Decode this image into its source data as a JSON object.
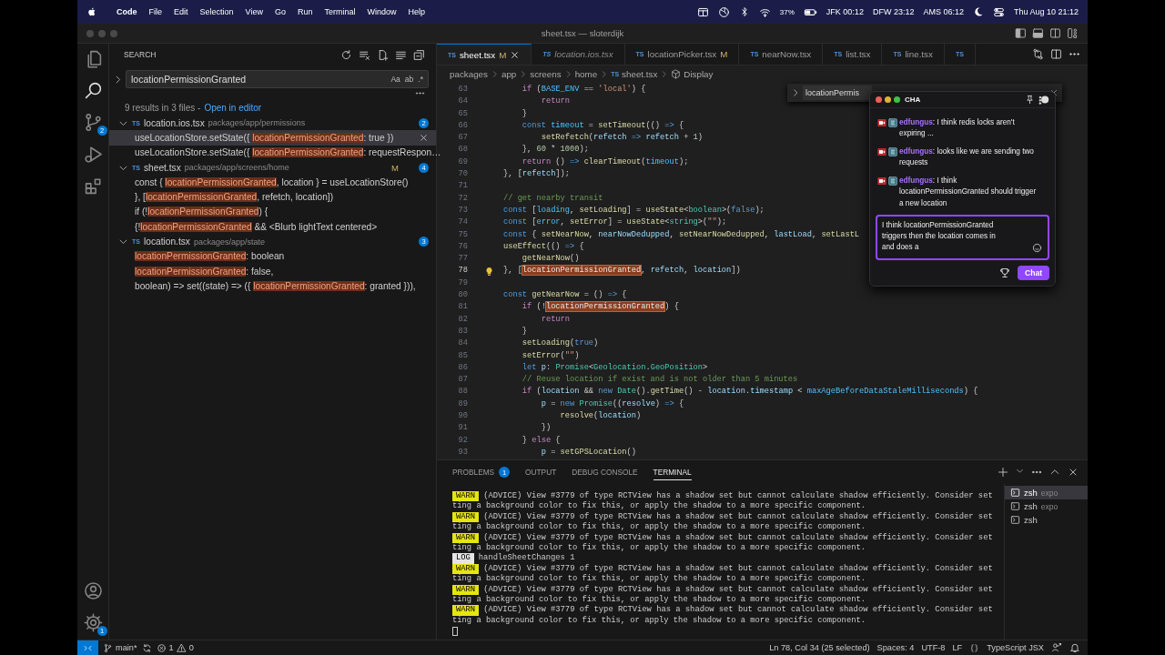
{
  "menu_bar": {
    "app": "Code",
    "items": [
      "File",
      "Edit",
      "Selection",
      "View",
      "Go",
      "Run",
      "Terminal",
      "Window",
      "Help"
    ],
    "battery": "37%",
    "clocks": [
      "JFK 00:12",
      "DFW 23:12",
      "AMS 06:12"
    ],
    "datetime": "Thu Aug 10 21:12"
  },
  "window": {
    "title": "sheet.tsx — sloterdijk"
  },
  "activity_bar": {
    "items": [
      {
        "kind": "files",
        "selected": false
      },
      {
        "kind": "search",
        "selected": true
      },
      {
        "kind": "scm",
        "selected": false,
        "badge": "2"
      },
      {
        "kind": "debug",
        "selected": false
      },
      {
        "kind": "extensions",
        "selected": false
      }
    ],
    "bottom": [
      {
        "kind": "account"
      },
      {
        "kind": "settings",
        "badge": "1"
      }
    ]
  },
  "sidebar": {
    "title": "SEARCH",
    "query": "locationPermissionGranted",
    "options": [
      "Aa",
      "ab",
      ".*"
    ],
    "summary": "9 results in 3 files -",
    "open_link": "Open in editor",
    "files": [
      {
        "lang": "TS",
        "name": "location.ios.tsx",
        "path": "packages/app/permissions",
        "count": "2",
        "expanded": true,
        "matches": [
          {
            "before": "useLocationStore.setState({ ",
            "match": "locationPermissionGranted",
            "after": ": true })",
            "selected": true
          },
          {
            "before": "useLocationStore.setState({ ",
            "match": "locationPermissionGranted",
            "after": ": requestRespon…",
            "selected": false
          }
        ]
      },
      {
        "lang": "TS",
        "name": "sheet.tsx",
        "path": "packages/app/screens/home",
        "status": "M",
        "count": "4",
        "expanded": true,
        "matches": [
          {
            "before": "const { ",
            "match": "locationPermissionGranted",
            "after": ", location } = useLocationStore()",
            "selected": false
          },
          {
            "before": "}, [",
            "match": "locationPermissionGranted",
            "after": ", refetch, location])",
            "selected": false
          },
          {
            "before": "if (!",
            "match": "locationPermissionGranted",
            "after": ") {",
            "selected": false
          },
          {
            "before": "{!",
            "match": "locationPermissionGranted",
            "after": " && <Blurb lightText centered>",
            "selected": false
          }
        ]
      },
      {
        "lang": "TS",
        "name": "location.tsx",
        "path": "packages/app/state",
        "count": "3",
        "expanded": true,
        "matches": [
          {
            "match": "locationPermissionGranted",
            "after": ": boolean",
            "selected": false
          },
          {
            "match": "locationPermissionGranted",
            "after": ": false,",
            "selected": false
          },
          {
            "before": "boolean) => set((state) => ({ ",
            "match": "locationPermissionGranted",
            "after": ": granted })),",
            "selected": false
          }
        ]
      }
    ]
  },
  "editor": {
    "tabs": [
      {
        "lang": "TS",
        "label": "sheet.tsx",
        "status": "M",
        "selected": true,
        "preview": false
      },
      {
        "lang": "TS",
        "label": "location.ios.tsx",
        "selected": false,
        "preview": true
      },
      {
        "lang": "TS",
        "label": "locationPicker.tsx",
        "status": "M",
        "selected": false,
        "preview": false
      },
      {
        "lang": "TS",
        "label": "nearNow.tsx",
        "selected": false,
        "preview": false
      },
      {
        "lang": "TS",
        "label": "list.tsx",
        "selected": false,
        "preview": false
      },
      {
        "lang": "TS",
        "label": "line.tsx",
        "selected": false,
        "preview": false
      },
      {
        "lang": "TS",
        "selected": false,
        "preview": false
      }
    ],
    "breadcrumbs": [
      {
        "label": "packages"
      },
      {
        "label": "app"
      },
      {
        "label": "screens"
      },
      {
        "label": "home"
      },
      {
        "lang": "TS",
        "label": "sheet.tsx"
      },
      {
        "kind": "symbol",
        "label": "Display"
      }
    ],
    "find_widget": {
      "query": "locationPermis"
    },
    "lines": [
      {
        "number": "63",
        "current": false,
        "segs": [
          {
            "text": "    if",
            "kind": "ctl"
          },
          {
            "text": " (",
            "kind": "plain"
          },
          {
            "text": "BASE_ENV",
            "kind": "const"
          },
          {
            "text": " == ",
            "kind": "plain"
          },
          {
            "text": "'local'",
            "kind": "str"
          },
          {
            "text": ") {",
            "kind": "plain"
          }
        ]
      },
      {
        "number": "64",
        "current": false,
        "segs": [
          {
            "text": "        return",
            "kind": "ctl"
          }
        ]
      },
      {
        "number": "65",
        "current": false,
        "segs": [
          {
            "text": "    }",
            "kind": "plain"
          }
        ]
      },
      {
        "number": "66",
        "current": false,
        "segs": [
          {
            "text": "    const",
            "kind": "kw"
          },
          {
            "text": " timeout",
            "kind": "const"
          },
          {
            "text": " = ",
            "kind": "plain"
          },
          {
            "text": "setTimeout",
            "kind": "fn"
          },
          {
            "text": "(() ",
            "kind": "plain"
          },
          {
            "text": "=>",
            "kind": "kw"
          },
          {
            "text": " {",
            "kind": "plain"
          }
        ]
      },
      {
        "number": "67",
        "current": false,
        "segs": [
          {
            "text": "        setRefetch",
            "kind": "fn"
          },
          {
            "text": "(",
            "kind": "plain"
          },
          {
            "text": "refetch",
            "kind": "var"
          },
          {
            "text": " => ",
            "kind": "kw"
          },
          {
            "text": "refetch",
            "kind": "var"
          },
          {
            "text": " + ",
            "kind": "plain"
          },
          {
            "text": "1",
            "kind": "num"
          },
          {
            "text": ")",
            "kind": "plain"
          }
        ]
      },
      {
        "number": "68",
        "current": false,
        "segs": [
          {
            "text": "    }, ",
            "kind": "plain"
          },
          {
            "text": "60",
            "kind": "num"
          },
          {
            "text": " * ",
            "kind": "plain"
          },
          {
            "text": "1000",
            "kind": "num"
          },
          {
            "text": ");",
            "kind": "plain"
          }
        ]
      },
      {
        "number": "69",
        "current": false,
        "segs": [
          {
            "text": "    return",
            "kind": "ctl"
          },
          {
            "text": " () ",
            "kind": "plain"
          },
          {
            "text": "=>",
            "kind": "kw"
          },
          {
            "text": " clearTimeout",
            "kind": "fn"
          },
          {
            "text": "(",
            "kind": "plain"
          },
          {
            "text": "timeout",
            "kind": "const"
          },
          {
            "text": ");",
            "kind": "plain"
          }
        ]
      },
      {
        "number": "70",
        "current": false,
        "segs": [
          {
            "text": "}, [",
            "kind": "plain"
          },
          {
            "text": "refetch",
            "kind": "var"
          },
          {
            "text": "]);",
            "kind": "plain"
          }
        ]
      },
      {
        "number": "71",
        "current": false
      },
      {
        "number": "72",
        "current": false,
        "segs": [
          {
            "text": "// get nearby transit",
            "kind": "comment"
          }
        ]
      },
      {
        "number": "73",
        "current": false,
        "segs": [
          {
            "text": "const",
            "kind": "kw"
          },
          {
            "text": " [",
            "kind": "plain"
          },
          {
            "text": "loading",
            "kind": "const"
          },
          {
            "text": ", ",
            "kind": "plain"
          },
          {
            "text": "setLoading",
            "kind": "fn"
          },
          {
            "text": "] = ",
            "kind": "plain"
          },
          {
            "text": "useState",
            "kind": "fn"
          },
          {
            "text": "<",
            "kind": "plain"
          },
          {
            "text": "boolean",
            "kind": "type"
          },
          {
            "text": ">(",
            "kind": "plain"
          },
          {
            "text": "false",
            "kind": "kw"
          },
          {
            "text": ");",
            "kind": "plain"
          }
        ]
      },
      {
        "number": "74",
        "current": false,
        "segs": [
          {
            "text": "const",
            "kind": "kw"
          },
          {
            "text": " [",
            "kind": "plain"
          },
          {
            "text": "error",
            "kind": "const"
          },
          {
            "text": ", ",
            "kind": "plain"
          },
          {
            "text": "setError",
            "kind": "fn"
          },
          {
            "text": "] = ",
            "kind": "plain"
          },
          {
            "text": "useState",
            "kind": "fn"
          },
          {
            "text": "<",
            "kind": "plain"
          },
          {
            "text": "string",
            "kind": "type"
          },
          {
            "text": ">(",
            "kind": "plain"
          },
          {
            "text": "\"\"",
            "kind": "str"
          },
          {
            "text": ");",
            "kind": "plain"
          }
        ]
      },
      {
        "number": "75",
        "current": false,
        "segs": [
          {
            "text": "const",
            "kind": "kw"
          },
          {
            "text": " { ",
            "kind": "plain"
          },
          {
            "text": "setNearNow",
            "kind": "fn"
          },
          {
            "text": ", ",
            "kind": "plain"
          },
          {
            "text": "nearNowDedupped",
            "kind": "var"
          },
          {
            "text": ", ",
            "kind": "plain"
          },
          {
            "text": "setNearNowDedupped",
            "kind": "fn"
          },
          {
            "text": ", ",
            "kind": "plain"
          },
          {
            "text": "lastLoad",
            "kind": "var"
          },
          {
            "text": ", ",
            "kind": "plain"
          },
          {
            "text": "setLastL",
            "kind": "fn"
          }
        ]
      },
      {
        "number": "76",
        "current": false,
        "segs": [
          {
            "text": "useEffect",
            "kind": "fn"
          },
          {
            "text": "(() ",
            "kind": "plain"
          },
          {
            "text": "=>",
            "kind": "kw"
          },
          {
            "text": " {",
            "kind": "plain"
          }
        ]
      },
      {
        "number": "77",
        "current": false,
        "segs": [
          {
            "text": "    getNearNow",
            "kind": "fn"
          },
          {
            "text": "()",
            "kind": "plain"
          }
        ]
      },
      {
        "number": "78",
        "current": true,
        "segs": [
          {
            "text": "}, [",
            "kind": "plain"
          },
          {
            "text": "locationPermissionGranted",
            "kind": "match"
          },
          {
            "text": ", ",
            "kind": "plain"
          },
          {
            "text": "refetch",
            "kind": "var"
          },
          {
            "text": ", ",
            "kind": "plain"
          },
          {
            "text": "location",
            "kind": "var"
          },
          {
            "text": "])",
            "kind": "plain"
          }
        ]
      },
      {
        "number": "79",
        "current": false
      },
      {
        "number": "80",
        "current": false,
        "segs": [
          {
            "text": "const",
            "kind": "kw"
          },
          {
            "text": " getNearNow",
            "kind": "fn"
          },
          {
            "text": " = () ",
            "kind": "plain"
          },
          {
            "text": "=>",
            "kind": "kw"
          },
          {
            "text": " {",
            "kind": "plain"
          }
        ]
      },
      {
        "number": "81",
        "current": false,
        "segs": [
          {
            "text": "    if",
            "kind": "ctl"
          },
          {
            "text": " (!",
            "kind": "plain"
          },
          {
            "text": "locationPermissionGranted",
            "kind": "match"
          },
          {
            "text": ") {",
            "kind": "plain"
          }
        ]
      },
      {
        "number": "82",
        "current": false,
        "segs": [
          {
            "text": "        return",
            "kind": "ctl"
          }
        ]
      },
      {
        "number": "83",
        "current": false,
        "segs": [
          {
            "text": "    }",
            "kind": "plain"
          }
        ]
      },
      {
        "number": "84",
        "current": false,
        "segs": [
          {
            "text": "    setLoading",
            "kind": "fn"
          },
          {
            "text": "(",
            "kind": "plain"
          },
          {
            "text": "true",
            "kind": "kw"
          },
          {
            "text": ")",
            "kind": "plain"
          }
        ]
      },
      {
        "number": "85",
        "current": false,
        "segs": [
          {
            "text": "    setError",
            "kind": "fn"
          },
          {
            "text": "(",
            "kind": "plain"
          },
          {
            "text": "\"\"",
            "kind": "str"
          },
          {
            "text": ")",
            "kind": "plain"
          }
        ]
      },
      {
        "number": "86",
        "current": false,
        "segs": [
          {
            "text": "    let",
            "kind": "kw"
          },
          {
            "text": " p",
            "kind": "var"
          },
          {
            "text": ": ",
            "kind": "plain"
          },
          {
            "text": "Promise",
            "kind": "type"
          },
          {
            "text": "<",
            "kind": "plain"
          },
          {
            "text": "Geolocation",
            "kind": "type"
          },
          {
            "text": ".",
            "kind": "plain"
          },
          {
            "text": "GeoPosition",
            "kind": "type"
          },
          {
            "text": ">",
            "kind": "plain"
          }
        ]
      },
      {
        "number": "87",
        "current": false,
        "segs": [
          {
            "text": "    // Reuse location if exist and is not older than 5 minutes",
            "kind": "comment"
          }
        ]
      },
      {
        "number": "88",
        "current": false,
        "segs": [
          {
            "text": "    if",
            "kind": "ctl"
          },
          {
            "text": " (",
            "kind": "plain"
          },
          {
            "text": "location",
            "kind": "var"
          },
          {
            "text": " && ",
            "kind": "plain"
          },
          {
            "text": "new",
            "kind": "kw"
          },
          {
            "text": " Date",
            "kind": "type"
          },
          {
            "text": "().",
            "kind": "plain"
          },
          {
            "text": "getTime",
            "kind": "fn"
          },
          {
            "text": "() - ",
            "kind": "plain"
          },
          {
            "text": "location",
            "kind": "var"
          },
          {
            "text": ".",
            "kind": "plain"
          },
          {
            "text": "timestamp",
            "kind": "var"
          },
          {
            "text": " < ",
            "kind": "plain"
          },
          {
            "text": "maxAgeBeforeDataStaleMilliseconds",
            "kind": "const"
          },
          {
            "text": ") {",
            "kind": "plain"
          }
        ]
      },
      {
        "number": "89",
        "current": false,
        "segs": [
          {
            "text": "        p",
            "kind": "var"
          },
          {
            "text": " = ",
            "kind": "plain"
          },
          {
            "text": "new",
            "kind": "kw"
          },
          {
            "text": " Promise",
            "kind": "type"
          },
          {
            "text": "((",
            "kind": "plain"
          },
          {
            "text": "resolve",
            "kind": "var"
          },
          {
            "text": ") ",
            "kind": "plain"
          },
          {
            "text": "=>",
            "kind": "kw"
          },
          {
            "text": " {",
            "kind": "plain"
          }
        ]
      },
      {
        "number": "90",
        "current": false,
        "segs": [
          {
            "text": "            resolve",
            "kind": "fn"
          },
          {
            "text": "(",
            "kind": "plain"
          },
          {
            "text": "location",
            "kind": "var"
          },
          {
            "text": ")",
            "kind": "plain"
          }
        ]
      },
      {
        "number": "91",
        "current": false,
        "segs": [
          {
            "text": "        })",
            "kind": "plain"
          }
        ]
      },
      {
        "number": "92",
        "current": false,
        "segs": [
          {
            "text": "    } ",
            "kind": "plain"
          },
          {
            "text": "else",
            "kind": "ctl"
          },
          {
            "text": " {",
            "kind": "plain"
          }
        ]
      },
      {
        "number": "93",
        "current": false,
        "segs": [
          {
            "text": "        p",
            "kind": "var"
          },
          {
            "text": " = ",
            "kind": "plain"
          },
          {
            "text": "setGPSLocation",
            "kind": "fn"
          },
          {
            "text": "()",
            "kind": "plain"
          }
        ]
      }
    ]
  },
  "chat": {
    "title": "CHA",
    "messages": [
      {
        "user": "edfungus",
        "text": ": I think redis locks aren't expiring ..."
      },
      {
        "user": "edfungus",
        "text": ": looks like we are sending two requests"
      },
      {
        "user": "edfungus",
        "text": ": I think locationPermissionGranted should trigger a new location"
      }
    ],
    "draft": "I think locationPermissionGranted triggers then the location comes in and does a",
    "send": "Chat"
  },
  "panel": {
    "tabs": [
      {
        "label": "PROBLEMS",
        "badge": "1",
        "selected": false
      },
      {
        "label": "OUTPUT",
        "selected": false
      },
      {
        "label": "DEBUG CONSOLE",
        "selected": false
      },
      {
        "label": "TERMINAL",
        "selected": true
      }
    ],
    "terminal_lines": [
      {
        "kind": "warn",
        "badge": "WARN",
        "text": "(ADVICE) View #3779 of type RCTView has a shadow set but cannot calculate shadow efficiently. Consider set"
      },
      {
        "kind": "plain",
        "text": "ting a background color to fix this, or apply the shadow to a more specific component."
      },
      {
        "kind": "warn",
        "badge": "WARN",
        "text": "(ADVICE) View #3779 of type RCTView has a shadow set but cannot calculate shadow efficiently. Consider set"
      },
      {
        "kind": "plain",
        "text": "ting a background color to fix this, or apply the shadow to a more specific component."
      },
      {
        "kind": "warn",
        "badge": "WARN",
        "text": "(ADVICE) View #3779 of type RCTView has a shadow set but cannot calculate shadow efficiently. Consider set"
      },
      {
        "kind": "plain",
        "text": "ting a background color to fix this, or apply the shadow to a more specific component."
      },
      {
        "kind": "log",
        "badge": "LOG",
        "text": "handleSheetChanges 1"
      },
      {
        "kind": "warn",
        "badge": "WARN",
        "text": "(ADVICE) View #3779 of type RCTView has a shadow set but cannot calculate shadow efficiently. Consider set"
      },
      {
        "kind": "plain",
        "text": "ting a background color to fix this, or apply the shadow to a more specific component."
      },
      {
        "kind": "warn",
        "badge": "WARN",
        "text": "(ADVICE) View #3779 of type RCTView has a shadow set but cannot calculate shadow efficiently. Consider set"
      },
      {
        "kind": "plain",
        "text": "ting a background color to fix this, or apply the shadow to a more specific component."
      },
      {
        "kind": "warn",
        "badge": "WARN",
        "text": "(ADVICE) View #3779 of type RCTView has a shadow set but cannot calculate shadow efficiently. Consider set"
      },
      {
        "kind": "plain",
        "text": "ting a background color to fix this, or apply the shadow to a more specific component."
      }
    ],
    "sessions": [
      {
        "name": "zsh",
        "detail": "expo",
        "selected": true
      },
      {
        "name": "zsh",
        "detail": "expo",
        "selected": false
      },
      {
        "name": "zsh",
        "selected": false
      }
    ]
  },
  "status_bar": {
    "branch": "main*",
    "errors": "1",
    "warnings": "0",
    "position": "Ln 78, Col 34 (25 selected)",
    "indent": "Spaces: 4",
    "encoding": "UTF-8",
    "eol": "LF",
    "language": "TypeScript JSX"
  }
}
